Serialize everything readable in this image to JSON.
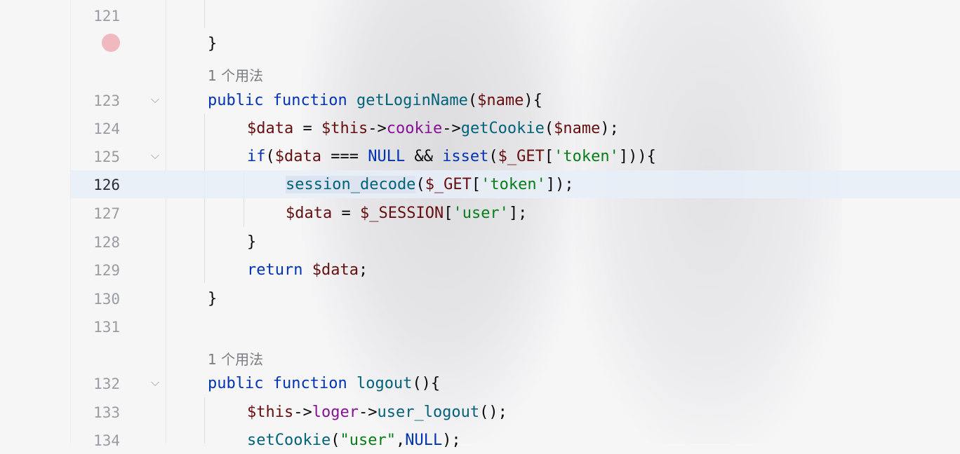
{
  "editor": {
    "usage_hint": "1 个用法",
    "lines": [
      {
        "num": "121",
        "code": ""
      },
      {
        "num": "",
        "code": "}"
      },
      {
        "num": "123",
        "code": "public function getLoginName($name){"
      },
      {
        "num": "124",
        "code": "$data = $this->cookie->getCookie($name);"
      },
      {
        "num": "125",
        "code": "if($data === NULL && isset($_GET['token'])){"
      },
      {
        "num": "126",
        "code": "session_decode($_GET['token']);"
      },
      {
        "num": "127",
        "code": "$data = $_SESSION['user'];"
      },
      {
        "num": "128",
        "code": "}"
      },
      {
        "num": "129",
        "code": "return $data;"
      },
      {
        "num": "130",
        "code": "}"
      },
      {
        "num": "131",
        "code": ""
      },
      {
        "num": "132",
        "code": "public function logout(){"
      },
      {
        "num": "133",
        "code": "$this->loger->user_logout();"
      },
      {
        "num": "134",
        "code": "setCookie(\"user\",NULL);"
      }
    ]
  },
  "colors": {
    "keyword": "#0033b3",
    "function": "#00627a",
    "variable": "#660e0e",
    "property": "#871094",
    "string": "#067d17",
    "breakpoint": "#f0b9bf"
  },
  "icons": {
    "fold": "chevron-down-icon",
    "breakpoint": "breakpoint-icon"
  }
}
